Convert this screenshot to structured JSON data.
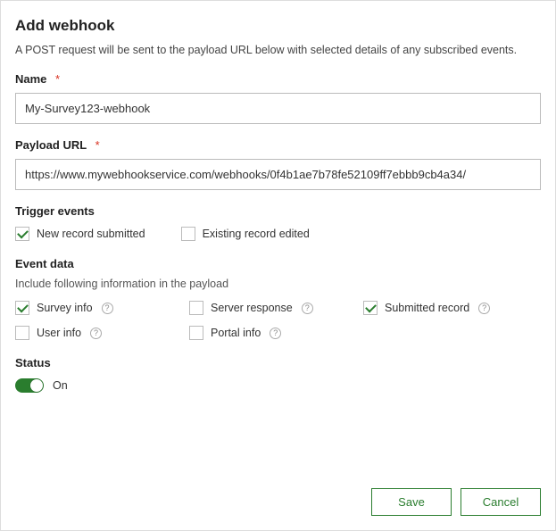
{
  "title": "Add webhook",
  "description": "A POST request will be sent to the payload URL below with selected details of any subscribed events.",
  "fields": {
    "name": {
      "label": "Name",
      "required": "*",
      "value": "My-Survey123-webhook"
    },
    "payload_url": {
      "label": "Payload URL",
      "required": "*",
      "value": "https://www.mywebhookservice.com/webhooks/0f4b1ae7b78fe52109ff7ebbb9cb4a34/"
    }
  },
  "trigger": {
    "label": "Trigger events",
    "items": [
      {
        "label": "New record submitted",
        "checked": true
      },
      {
        "label": "Existing record edited",
        "checked": false
      }
    ]
  },
  "event_data": {
    "label": "Event data",
    "subtext": "Include following information in the payload",
    "items": [
      {
        "label": "Survey info",
        "checked": true,
        "help": true
      },
      {
        "label": "Server response",
        "checked": false,
        "help": true
      },
      {
        "label": "Submitted record",
        "checked": true,
        "help": true
      },
      {
        "label": "User info",
        "checked": false,
        "help": true
      },
      {
        "label": "Portal info",
        "checked": false,
        "help": true
      }
    ]
  },
  "status": {
    "label": "Status",
    "value_label": "On",
    "on": true
  },
  "buttons": {
    "save": "Save",
    "cancel": "Cancel"
  }
}
